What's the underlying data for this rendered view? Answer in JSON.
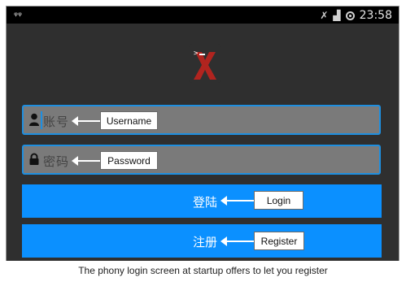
{
  "status_bar": {
    "left_icon": "signal-icon",
    "mute_icon": "mute-icon",
    "network_icon": "network-signal-icon",
    "battery_icon": "battery-icon",
    "time": "23:58"
  },
  "app": {
    "logo_icon": "app-logo-x-icon",
    "username_field": {
      "icon": "user-icon",
      "placeholder": "账号",
      "value": ""
    },
    "password_field": {
      "icon": "lock-icon",
      "placeholder": "密码",
      "value": ""
    },
    "login_button": {
      "label": "登陆"
    },
    "register_button": {
      "label": "注册"
    }
  },
  "annotations": {
    "username": "Username",
    "password": "Password",
    "login": "Login",
    "register": "Register"
  },
  "caption": "The phony login screen at startup offers to let you register",
  "colors": {
    "accent": "#0b90ff",
    "field_border": "#1e8fe0",
    "background": "#2f2f2f",
    "logo_red": "#b1241f"
  }
}
